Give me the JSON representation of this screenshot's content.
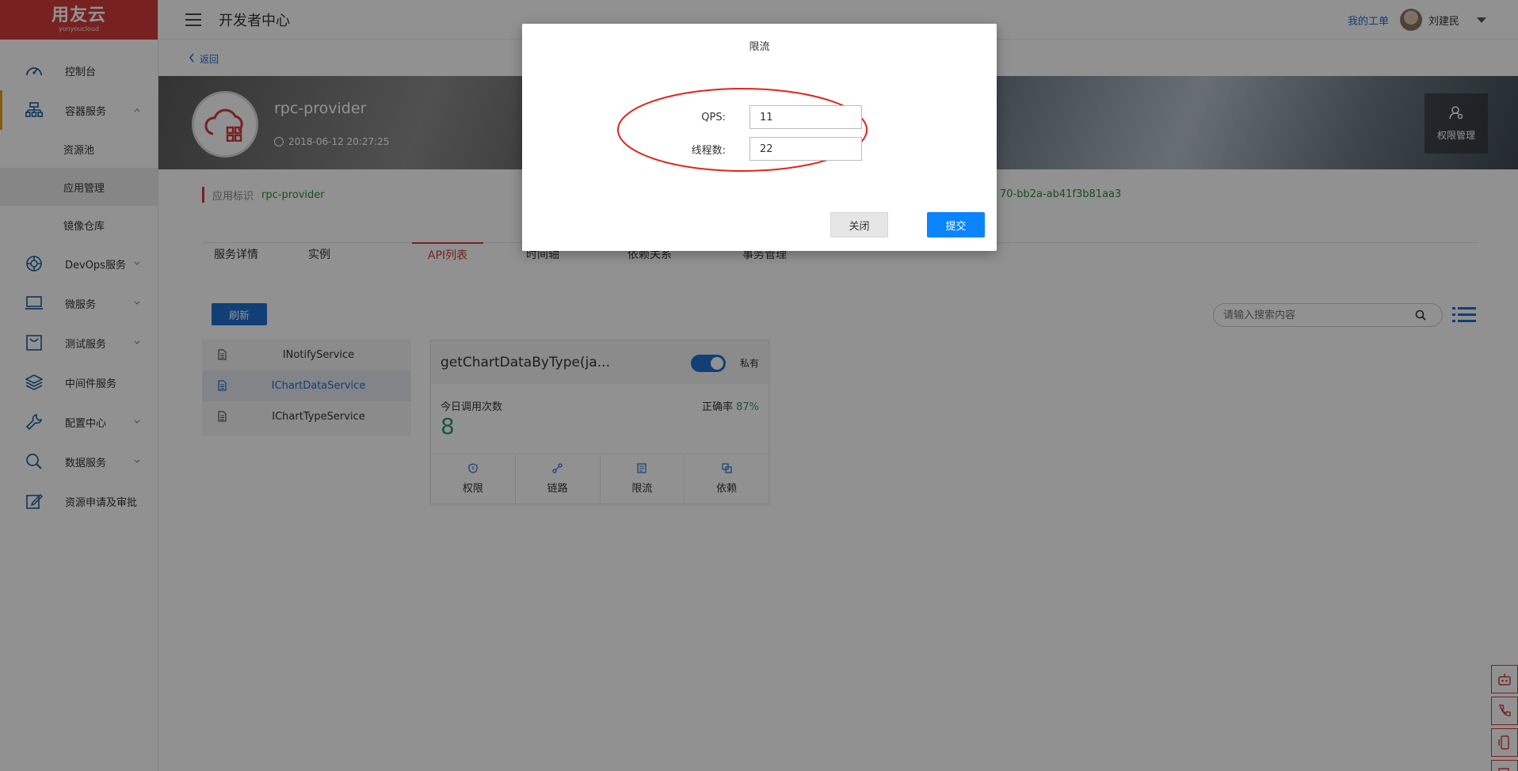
{
  "brand": {
    "logo_text": "用友云",
    "logo_sub": "yonyoucloud",
    "color": "#d23a3a"
  },
  "header": {
    "title": "开发者中心",
    "my_ticket": "我的工单",
    "username": "刘建民"
  },
  "sidebar": {
    "items": [
      {
        "label": "控制台",
        "icon": "dashboard-icon"
      },
      {
        "label": "容器服务",
        "icon": "container-icon",
        "expanded": true
      },
      {
        "label": "资源池",
        "sub": true
      },
      {
        "label": "应用管理",
        "sub": true,
        "selected": true
      },
      {
        "label": "镜像仓库",
        "sub": true
      },
      {
        "label": "DevOps服务",
        "icon": "devops-icon"
      },
      {
        "label": "微服务",
        "icon": "laptop-icon"
      },
      {
        "label": "测试服务",
        "icon": "test-icon"
      },
      {
        "label": "中间件服务",
        "icon": "layers-icon"
      },
      {
        "label": "配置中心",
        "icon": "wrench-icon"
      },
      {
        "label": "数据服务",
        "icon": "search-data-icon"
      },
      {
        "label": "资源申请及审批",
        "icon": "approval-icon"
      }
    ]
  },
  "main": {
    "back_label": "返回",
    "app": {
      "name": "rpc-provider",
      "created": "2018-06-12 20:27:25"
    },
    "perm_mgmt_label": "权限管理",
    "identity_label": "应用标识",
    "identity_value": "rpc-provider",
    "uuid_partial": "70-bb2a-ab41f3b81aa3",
    "tabs": [
      {
        "label": "服务详情"
      },
      {
        "label": "实例"
      },
      {
        "label": "API列表",
        "active": true
      },
      {
        "label": "时间轴"
      },
      {
        "label": "依赖关系"
      },
      {
        "label": "事务管理"
      }
    ],
    "refresh_label": "刷新",
    "search_placeholder": "请输入搜索内容",
    "services": [
      {
        "label": "INotifyService"
      },
      {
        "label": "IChartDataService",
        "selected": true
      },
      {
        "label": "IChartTypeService"
      }
    ],
    "api_card": {
      "name": "getChartDataByType(ja...",
      "visibility_on": true,
      "visibility_label": "私有",
      "calls_label": "今日调用次数",
      "calls_value": "8",
      "accuracy_label": "正确率",
      "accuracy_value": "87%",
      "actions": [
        {
          "label": "权限",
          "icon": "shield-icon"
        },
        {
          "label": "链路",
          "icon": "link-icon"
        },
        {
          "label": "限流",
          "icon": "throttle-icon"
        },
        {
          "label": "依赖",
          "icon": "dependency-icon"
        }
      ]
    }
  },
  "modal": {
    "title": "限流",
    "qps_label": "QPS:",
    "qps_value": "11",
    "threads_label": "线程数:",
    "threads_value": "22",
    "close_label": "关闭",
    "submit_label": "提交",
    "accent": "#0a84ff",
    "highlight_color": "#e0241b"
  }
}
